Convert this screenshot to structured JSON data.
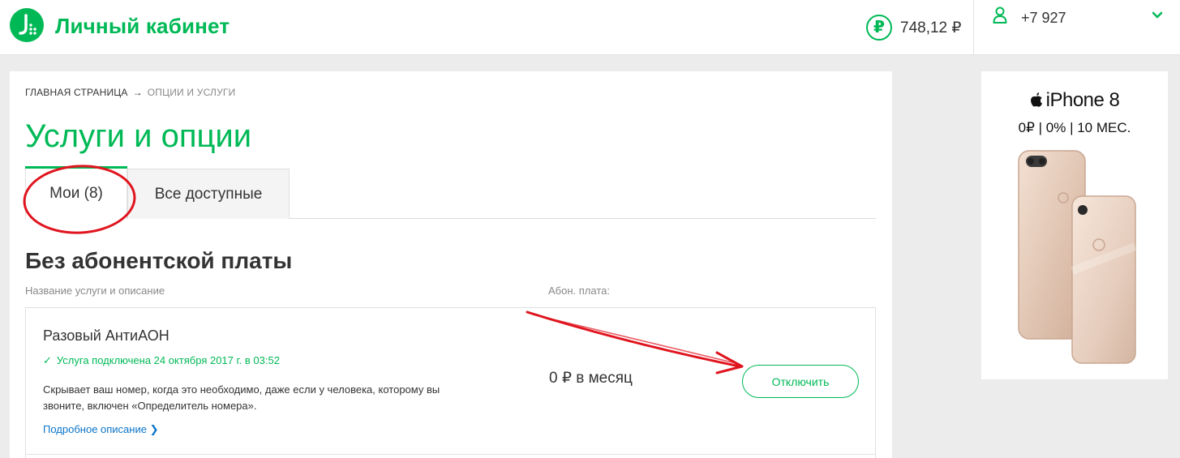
{
  "header": {
    "brand": "Личный кабинет",
    "balance": "748,12 ₽",
    "balance_icon": "₽",
    "phone": "+7 927"
  },
  "breadcrumb": {
    "home": "ГЛАВНАЯ СТРАНИЦА",
    "arrow": "→",
    "current": "ОПЦИИ И УСЛУГИ"
  },
  "page_title": "Услуги и опции",
  "tabs": [
    {
      "label": "Мои (8)"
    },
    {
      "label": "Все доступные"
    }
  ],
  "section": {
    "title": "Без абонентской платы",
    "col_name": "Название услуги и описание",
    "col_fee": "Абон. плата:"
  },
  "service": {
    "name": "Разовый АнтиАОН",
    "status_check": "✓",
    "status": "Услуга подключена 24 октября 2017 г. в 03:52",
    "description": "Скрывает ваш номер, когда это необходимо, даже если у человека, которому вы звоните, включен «Определитель номера».",
    "more_link": "Подробное описание ❯",
    "price": "0 ₽ в месяц",
    "disconnect_label": "Отключить"
  },
  "ad": {
    "title": "iPhone 8",
    "terms": "0₽ | 0% | 10 МЕС."
  },
  "colors": {
    "brand_green": "#00b956",
    "annotation_red": "#e0141e",
    "link_blue": "#0a74c9"
  }
}
